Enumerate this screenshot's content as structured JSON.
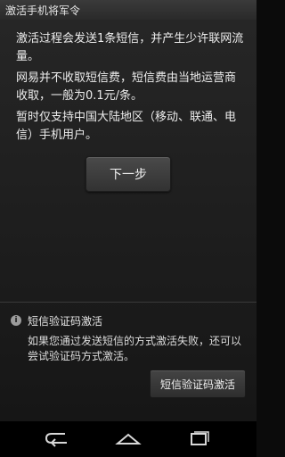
{
  "header": {
    "title": "激活手机将军令"
  },
  "body": {
    "para1": "激活过程会发送1条短信，并产生少许联网流量。",
    "para2": "网易并不收取短信费，短信费由当地运营商收取，一般为0.1元/条。",
    "para3": "暂时仅支持中国大陆地区（移动、联通、电信）手机用户。"
  },
  "next_button": {
    "label": "下一步"
  },
  "sms_section": {
    "icon": "info-icon",
    "heading": "短信验证码激活",
    "description": "如果您通过发送短信的方式激活失败，还可以尝试验证码方式激活。",
    "button_label": "短信验证码激活"
  },
  "navbar": {
    "icons": [
      "back-icon",
      "home-icon",
      "recent-apps-icon"
    ]
  }
}
